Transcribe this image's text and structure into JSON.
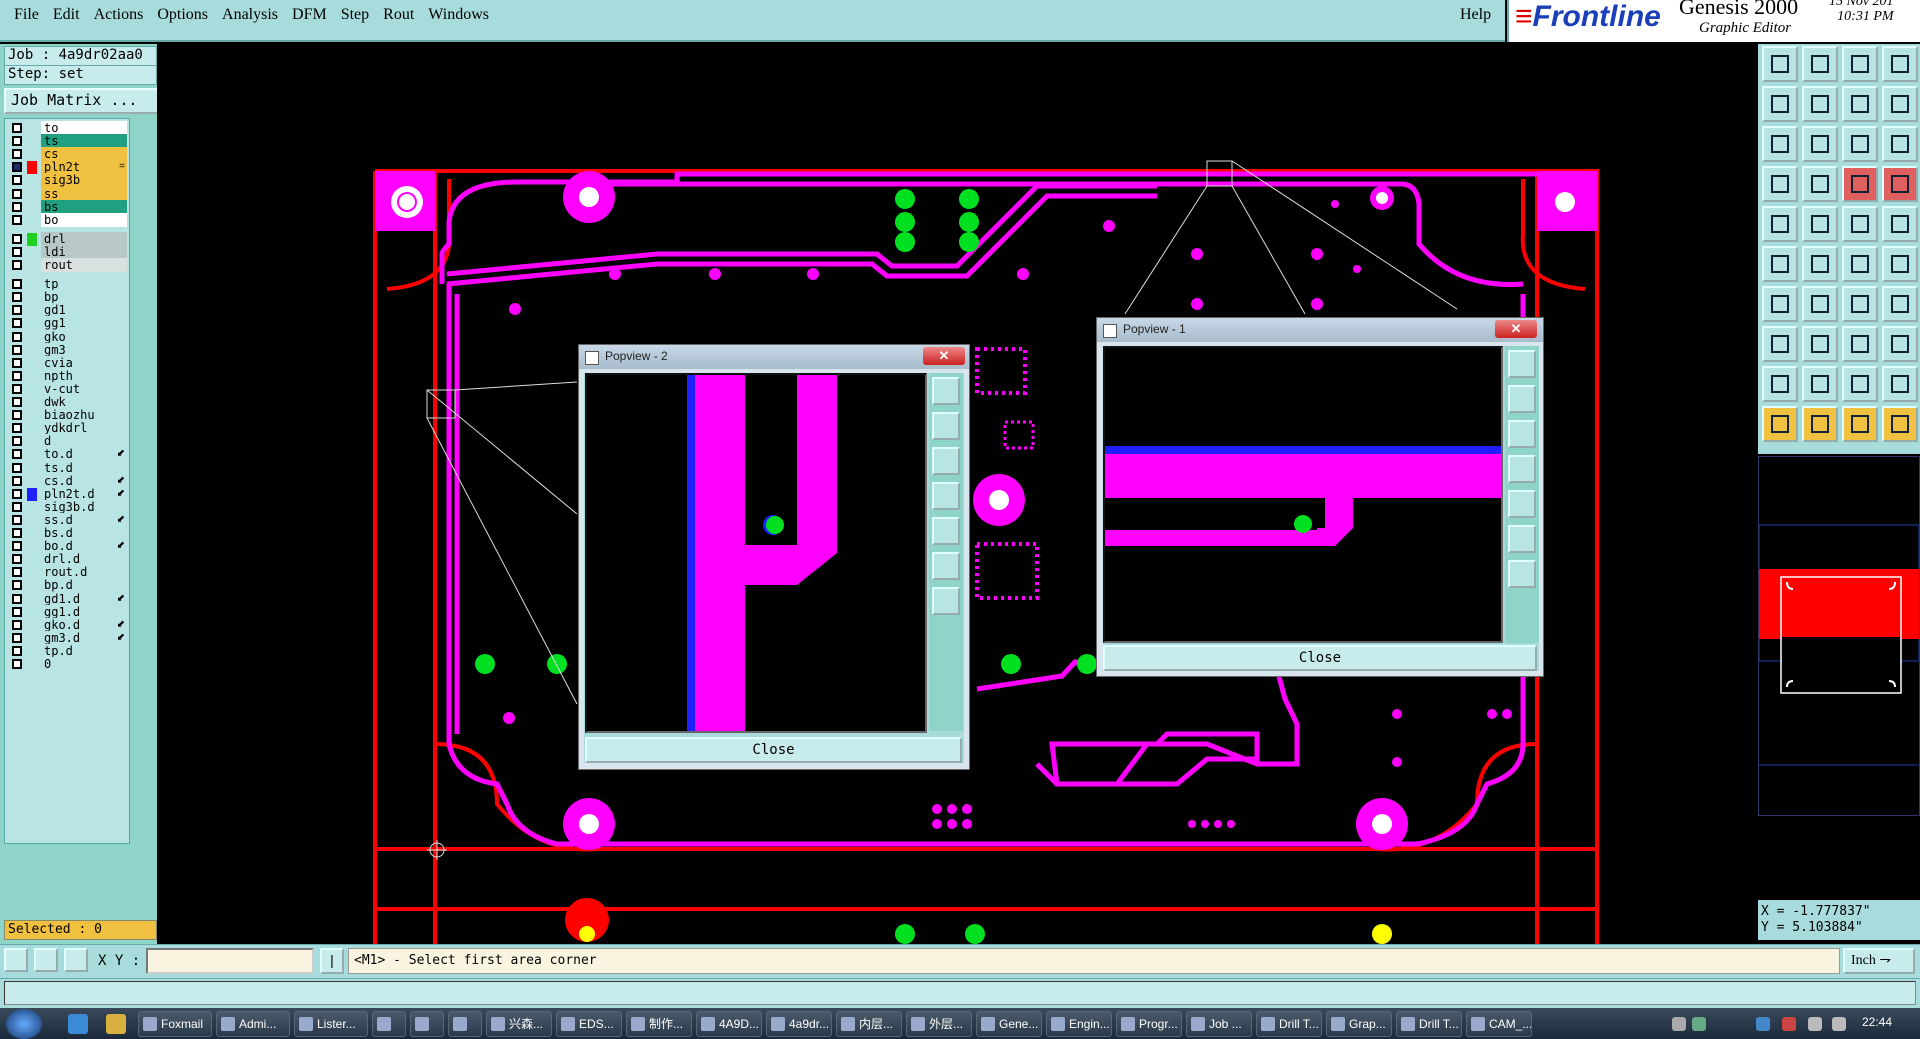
{
  "menubar": {
    "items": [
      "File",
      "Edit",
      "Actions",
      "Options",
      "Analysis",
      "DFM",
      "Step",
      "Rout",
      "Windows"
    ],
    "help": "Help"
  },
  "brand": {
    "logo": "Frontline",
    "product": "Genesis 2000",
    "subtitle": "Graphic Editor",
    "date": "15 Nov 201",
    "time": "10:31 PM"
  },
  "job": {
    "job_label": "Job : 4a9dr02aa0",
    "step_label": "Step: set",
    "job_matrix_button": "Job Matrix ..."
  },
  "layers": [
    {
      "name": "to",
      "color": "#ffffff",
      "mark": ""
    },
    {
      "name": "ts",
      "color": "#20a080",
      "mark": ""
    },
    {
      "name": "cs",
      "color": "#f0c040",
      "mark": ""
    },
    {
      "name": "pln2t",
      "color": "#f0c040",
      "mark": "=",
      "active": true
    },
    {
      "name": "sig3b",
      "color": "#f0c040",
      "mark": ""
    },
    {
      "name": "ss",
      "color": "#f0c040",
      "mark": ""
    },
    {
      "name": "bs",
      "color": "#20a080",
      "mark": ""
    },
    {
      "name": "bo",
      "color": "#ffffff",
      "mark": ""
    },
    {
      "name": "drl",
      "color": "#b8c8c8",
      "mark": "",
      "swatch": "#20d020"
    },
    {
      "name": "ldi",
      "color": "#b8c8c8",
      "mark": ""
    },
    {
      "name": "rout",
      "color": "#d8e0e0",
      "mark": ""
    },
    {
      "name": "tp",
      "color": "#b8e4e4",
      "mark": ""
    },
    {
      "name": "bp",
      "color": "#b8e4e4",
      "mark": ""
    },
    {
      "name": "gd1",
      "color": "#b8e4e4",
      "mark": ""
    },
    {
      "name": "gg1",
      "color": "#b8e4e4",
      "mark": ""
    },
    {
      "name": "gko",
      "color": "#b8e4e4",
      "mark": ""
    },
    {
      "name": "gm3",
      "color": "#b8e4e4",
      "mark": ""
    },
    {
      "name": "cvia",
      "color": "#b8e4e4",
      "mark": ""
    },
    {
      "name": "npth",
      "color": "#b8e4e4",
      "mark": ""
    },
    {
      "name": "v-cut",
      "color": "#b8e4e4",
      "mark": ""
    },
    {
      "name": "dwk",
      "color": "#b8e4e4",
      "mark": ""
    },
    {
      "name": "biaozhu",
      "color": "#b8e4e4",
      "mark": ""
    },
    {
      "name": "ydkdrl",
      "color": "#b8e4e4",
      "mark": ""
    },
    {
      "name": "d",
      "color": "#b8e4e4",
      "mark": ""
    },
    {
      "name": "to.d",
      "color": "#b8e4e4",
      "mark": "⬋"
    },
    {
      "name": "ts.d",
      "color": "#b8e4e4",
      "mark": ""
    },
    {
      "name": "cs.d",
      "color": "#b8e4e4",
      "mark": "⬋"
    },
    {
      "name": "pln2t.d",
      "color": "#b8e4e4",
      "mark": "⬋",
      "swatch": "#2020ff"
    },
    {
      "name": "sig3b.d",
      "color": "#b8e4e4",
      "mark": ""
    },
    {
      "name": "ss.d",
      "color": "#b8e4e4",
      "mark": "⬋"
    },
    {
      "name": "bs.d",
      "color": "#b8e4e4",
      "mark": ""
    },
    {
      "name": "bo.d",
      "color": "#b8e4e4",
      "mark": "⬋"
    },
    {
      "name": "drl.d",
      "color": "#b8e4e4",
      "mark": ""
    },
    {
      "name": "rout.d",
      "color": "#b8e4e4",
      "mark": ""
    },
    {
      "name": "bp.d",
      "color": "#b8e4e4",
      "mark": ""
    },
    {
      "name": "gd1.d",
      "color": "#b8e4e4",
      "mark": "⬋"
    },
    {
      "name": "gg1.d",
      "color": "#b8e4e4",
      "mark": ""
    },
    {
      "name": "gko.d",
      "color": "#b8e4e4",
      "mark": "⬋"
    },
    {
      "name": "gm3.d",
      "color": "#b8e4e4",
      "mark": "⬋"
    },
    {
      "name": "tp.d",
      "color": "#b8e4e4",
      "mark": ""
    },
    {
      "name": "0",
      "color": "#b8e4e4",
      "mark": ""
    }
  ],
  "selected_label": "Selected : 0",
  "popview2": {
    "title": "Popview - 2",
    "close_label": "Close"
  },
  "popview1": {
    "title": "Popview - 1",
    "close_label": "Close"
  },
  "coords": {
    "x": "X = -1.777837\"",
    "y": "Y = 5.103884\""
  },
  "bottombar": {
    "xy_label": "X Y :",
    "xy_value": "",
    "message": "<M1> - Select first area corner",
    "unit": "Inch"
  },
  "taskbar": {
    "tasks": [
      "Foxmail",
      "Admi...",
      "Lister...",
      "",
      "",
      "",
      "兴森...",
      "EDS...",
      "制作...",
      "4A9D...",
      "4a9dr...",
      "内层...",
      "外层...",
      "Gene...",
      "Engin...",
      "Progr...",
      "Job ...",
      "Drill T...",
      "Grap...",
      "Drill T...",
      "CAM_..."
    ],
    "clock": "22:44"
  },
  "colors": {
    "board_outline": "#ff0000",
    "trace": "#ff00ff",
    "pad": "#00ff00",
    "panel_bg": "#8fd4c8",
    "menu_bg": "#a8dcdc"
  }
}
